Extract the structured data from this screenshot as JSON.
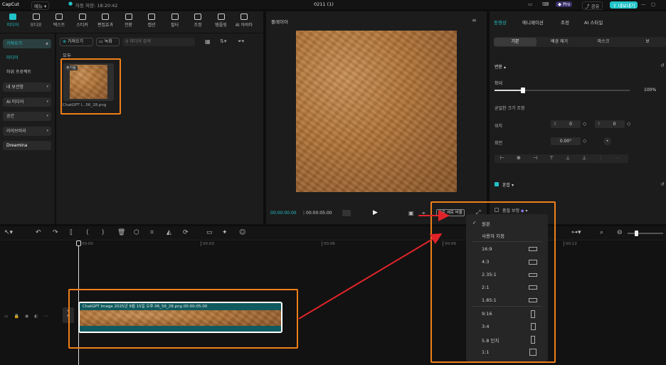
{
  "app": {
    "name": "CapCut",
    "menu": "메뉴",
    "autosave": "자동 저장: 18:20:42",
    "project_title": "0211 (1)",
    "pro": "Pro",
    "share": "공유",
    "export": "내보내기"
  },
  "top_tabs": [
    {
      "label": "미디어",
      "icon": "media-icon"
    },
    {
      "label": "오디오",
      "icon": "audio-icon"
    },
    {
      "label": "텍스트",
      "icon": "text-icon"
    },
    {
      "label": "스티커",
      "icon": "sticker-icon"
    },
    {
      "label": "편집효과",
      "icon": "effects-icon"
    },
    {
      "label": "전환",
      "icon": "transition-icon"
    },
    {
      "label": "캡션",
      "icon": "caption-icon"
    },
    {
      "label": "필터",
      "icon": "filter-icon"
    },
    {
      "label": "조정",
      "icon": "adjust-icon"
    },
    {
      "label": "템플릿",
      "icon": "template-icon"
    },
    {
      "label": "AI 아바타",
      "icon": "avatar-icon"
    }
  ],
  "sidebar": {
    "import": "가져오기",
    "media": "미디어",
    "subproject": "하위 프로젝트",
    "my_storage": "내 보관함",
    "ai_media": "AI 미디어",
    "space": "공간",
    "library": "라이브러리",
    "dreamina": "Dreamina"
  },
  "media_panel": {
    "import_button": "가져오기",
    "record_button": "녹화",
    "search_placeholder": "미디어 검색",
    "section_all": "모두",
    "added_badge": "추가됨",
    "file_name": "ChatGPT I...56_28.png"
  },
  "player": {
    "title": "플레이어",
    "time_current": "00:00:00:00",
    "time_total": "00:00:05:00",
    "ratio_button": "가로 세로 비율"
  },
  "props": {
    "tabs": [
      "동영상",
      "애니메이션",
      "조정",
      "AI 스타일"
    ],
    "subtabs": [
      "기본",
      "배경 제거",
      "마스크",
      "보"
    ],
    "transform": "변환",
    "scale": "확대",
    "scale_value": "100%",
    "uniform_scale": "균일한 크기 조정",
    "position": "위치",
    "pos_x_label": "X",
    "pos_x": "0",
    "pos_y_label": "Y",
    "pos_y": "0",
    "rotate": "회전",
    "rotate_value": "0.00°",
    "blend": "혼합",
    "quality": "품질 보정"
  },
  "timeline": {
    "ruler": [
      "00:00",
      "00:03",
      "00:06",
      "00:09",
      "00:12"
    ],
    "clip_label": "ChatGPT Image 2025년 9월 15일 오후 06_56_28.png   00:00:05:00"
  },
  "ratio_menu": {
    "items": [
      "원본",
      "사용자 지정",
      "16:9",
      "4:3",
      "2.35:1",
      "2:1",
      "1.85:1",
      "9:16",
      "3:4",
      "5.8 인치",
      "1:1"
    ],
    "selected": "원본"
  },
  "colors": {
    "accent": "#22c3c8",
    "annotation_orange": "#f07f1a",
    "annotation_red": "#e0242a",
    "clip_header": "#0f5a5e"
  }
}
